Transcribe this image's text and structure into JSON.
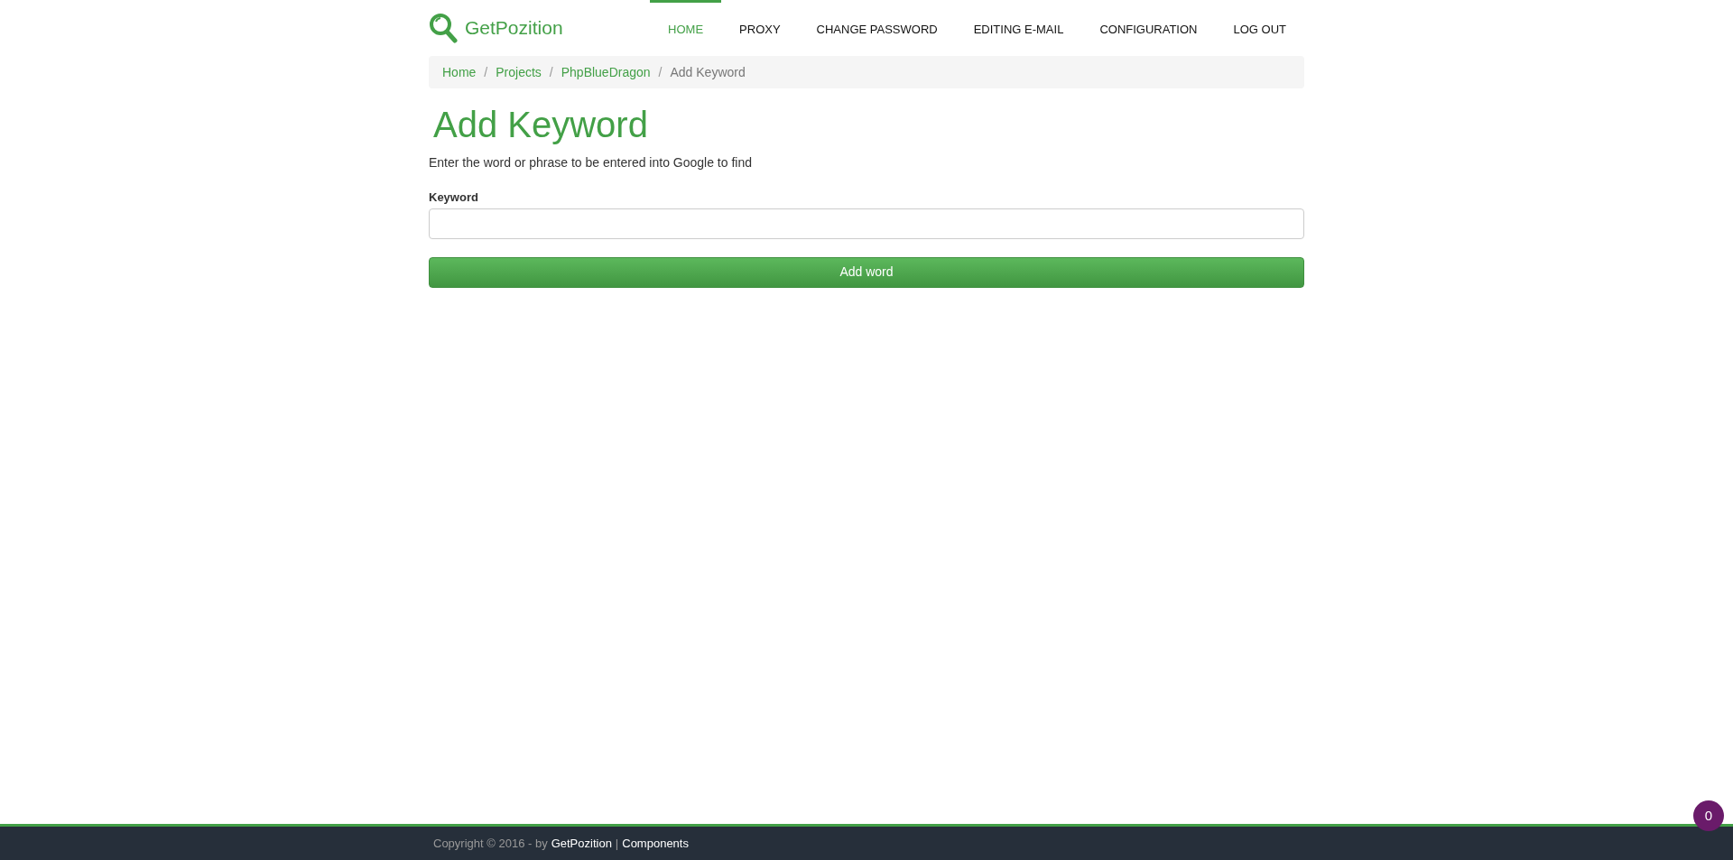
{
  "brand": "GetPozition",
  "nav": [
    {
      "label": "HOME",
      "selected": true
    },
    {
      "label": "PROXY",
      "selected": false
    },
    {
      "label": "CHANGE PASSWORD",
      "selected": false
    },
    {
      "label": "EDITING E-MAIL",
      "selected": false
    },
    {
      "label": "CONFIGURATION",
      "selected": false
    },
    {
      "label": "LOG OUT",
      "selected": false
    }
  ],
  "breadcrumb": [
    "Home",
    "Projects",
    "PhpBlueDragon",
    "Add Keyword"
  ],
  "breadcrumb_separator": "/",
  "title": "Add Keyword",
  "description": "Enter the word or phrase to be entered into Google to find",
  "field": {
    "label": "Keyword"
  },
  "submit": "Add word",
  "footer": {
    "copyright": "Copyright © 2016 - by",
    "links": [
      "GetPozition",
      "Components"
    ],
    "separator": "|"
  },
  "badge": "0"
}
